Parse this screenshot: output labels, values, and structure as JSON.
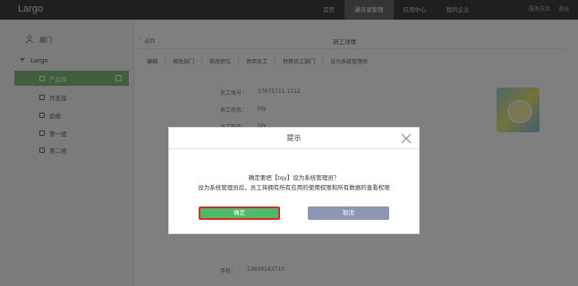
{
  "app": {
    "logo": "Largo"
  },
  "topnav": {
    "items": [
      {
        "label": "首页",
        "active": false
      },
      {
        "label": "通讯录管理",
        "active": true
      },
      {
        "label": "应用中心",
        "active": false
      },
      {
        "label": "我的企业",
        "active": false
      }
    ],
    "right": [
      "服务支持",
      "退出"
    ]
  },
  "sidebar": {
    "header": "部门",
    "org": "Largo",
    "items": [
      {
        "label": "产品部",
        "active": true
      },
      {
        "label": "开发部",
        "active": false
      },
      {
        "label": "运维",
        "active": false
      },
      {
        "label": "第一组",
        "active": false
      },
      {
        "label": "第二组",
        "active": false
      }
    ]
  },
  "main": {
    "back_label": "返回",
    "title": "员工详情",
    "tabs": [
      "编辑",
      "修改部门",
      "修改职位",
      "停用员工",
      "转移员工部门",
      "设为系统管理员"
    ],
    "fields": [
      {
        "label": "员工账号：",
        "value": "17675711 1212"
      },
      {
        "label": "员工姓名：",
        "value": "tqy"
      },
      {
        "label": "员工职务：",
        "value": "tqy"
      }
    ],
    "phone_label": "手机：",
    "phone_value": "13608143710"
  },
  "dialog": {
    "title": "提示",
    "message_line1": "确定要把【tqy】设为系统管理员？",
    "message_line2": "设为系统管理员后，员工将拥有所有应用的使用权限和所有数据的查看权限",
    "ok_label": "确定",
    "cancel_label": "取消"
  },
  "colors": {
    "accent": "#4dbb6a",
    "highlight_border": "#d92b2b",
    "cancel": "#8e96b4"
  }
}
